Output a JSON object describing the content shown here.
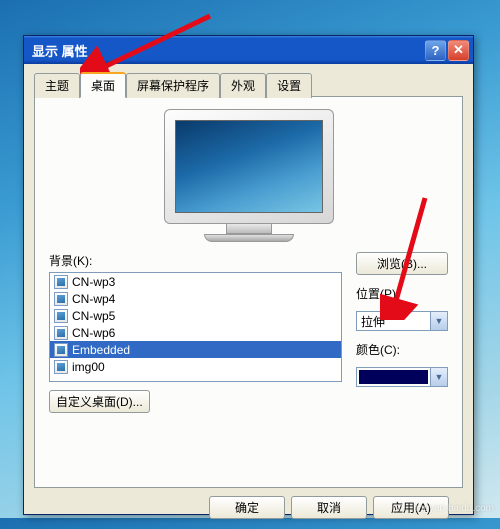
{
  "window": {
    "title": "显示 属性"
  },
  "tabs": {
    "0": {
      "label": "主题"
    },
    "1": {
      "label": "桌面"
    },
    "2": {
      "label": "屏幕保护程序"
    },
    "3": {
      "label": "外观"
    },
    "4": {
      "label": "设置"
    }
  },
  "background": {
    "label": "背景(K):",
    "items": {
      "0": {
        "label": "CN-wp3"
      },
      "1": {
        "label": "CN-wp4"
      },
      "2": {
        "label": "CN-wp5"
      },
      "3": {
        "label": "CN-wp6"
      },
      "4": {
        "label": "Embedded"
      },
      "5": {
        "label": "img00"
      }
    },
    "selected_index": 4
  },
  "browse": {
    "label": "浏览(B)..."
  },
  "position": {
    "label": "位置(P):",
    "value": "拉伸"
  },
  "color": {
    "label": "颜色(C):",
    "value": "#00005a"
  },
  "custom_desktop": {
    "label": "自定义桌面(D)..."
  },
  "buttons": {
    "ok": "确定",
    "cancel": "取消",
    "apply": "应用(A)"
  },
  "watermark": "jingyan.baidu.com"
}
